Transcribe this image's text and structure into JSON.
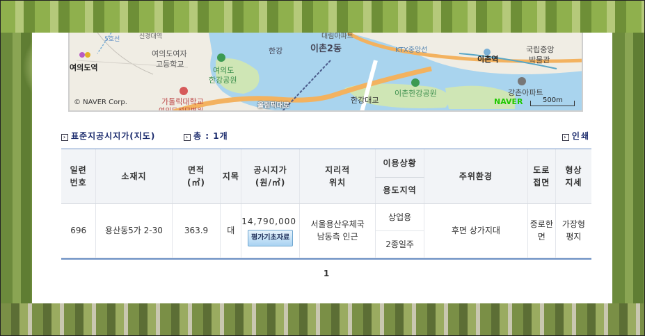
{
  "map": {
    "labels": {
      "station_yeouido": "여의도역",
      "school_yeouido_girls_1": "여의도여자",
      "school_yeouido_girls_2": "고등학교",
      "park_yeouido_1": "여의도",
      "park_yeouido_2": "한강공원",
      "catholic_univ": "가톨릭대학교",
      "hospital": "여의도성모병원",
      "hangang_river": "한강",
      "ichon2dong": "이촌2동",
      "daerim_apt": "대림아파트",
      "ktx_line": "KTX중앙선",
      "ichon_station": "이촌역",
      "museum_1": "국립중앙",
      "museum_2": "박물관",
      "ichon_park": "이촌한강공원",
      "hangang_bridge": "한강대교",
      "gangchon_apt": "강촌아파트",
      "olympic_road": "올림픽대로",
      "line5": "5호선",
      "top_cut": "신경대역"
    },
    "copyright": "© NAVER Corp.",
    "logo": "NAVER",
    "scale": "500m",
    "colors": {
      "water": "#a9d4ee",
      "park": "#cfe6b5",
      "road": "#f3b25f",
      "land": "#f0ede4"
    }
  },
  "section": {
    "title": "표준지공시지가(지도)",
    "count_label": "총 :",
    "count_value": "1개",
    "print_label": "인쇄"
  },
  "table": {
    "headers": {
      "serial": "일련\n번호",
      "address": "소재지",
      "area": "면적\n(㎡)",
      "land_category": "지목",
      "price": "공시지가\n(원/㎡)",
      "geo_position": "지리적\n위치",
      "usage_status": "이용상황",
      "zoning": "용도지역",
      "surroundings": "주위환경",
      "road_access": "도로\n접면",
      "shape_terrain": "형상\n지세"
    },
    "rows": [
      {
        "serial": "696",
        "address": "용산동5가 2-30",
        "area": "363.9",
        "land_category": "대",
        "price": "14,790,000",
        "button": "평가기초자료",
        "geo_position": "서울용산우체국\n남동측 인근",
        "usage_status": "상업용",
        "zoning": "2종일주",
        "surroundings": "후면 상가지대",
        "road_access": "중로한\n면",
        "shape_terrain": "가장형\n평지"
      }
    ]
  },
  "pagination": {
    "current": "1"
  }
}
